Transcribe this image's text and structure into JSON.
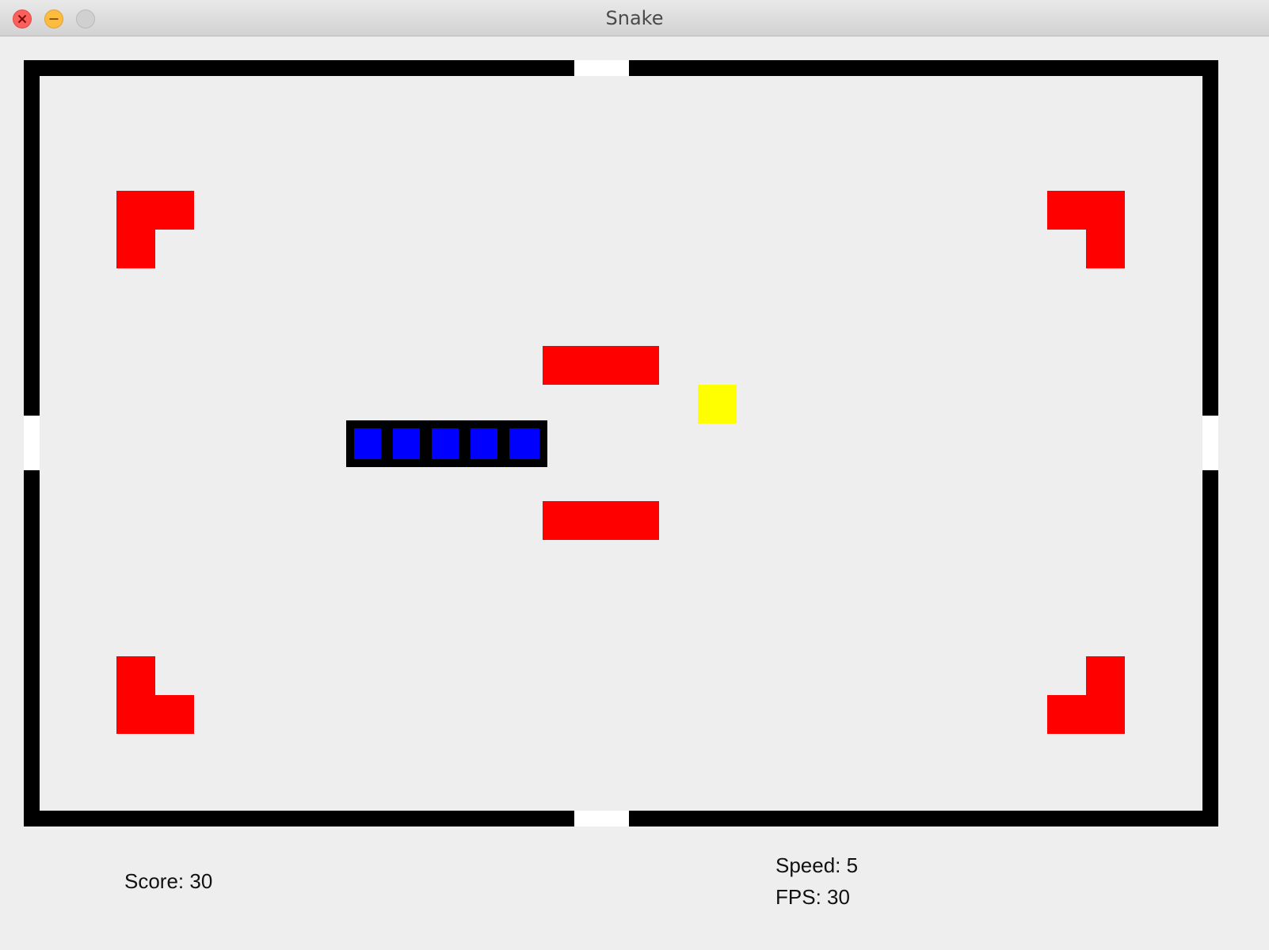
{
  "window": {
    "title": "Snake",
    "controls": [
      "close",
      "minimize",
      "maximize"
    ]
  },
  "colors": {
    "background": "#eeeeee",
    "wall": "#000000",
    "gate": "#ffffff",
    "obstacle": "#ff0000",
    "food": "#ffff00",
    "snake_body": "#0000ff",
    "snake_outline": "#000000"
  },
  "game": {
    "snake_length": 5,
    "direction": "right",
    "food_count": 1,
    "obstacles": [
      "corner-top-left",
      "corner-top-right",
      "corner-bottom-left",
      "corner-bottom-right",
      "bar-upper-center",
      "bar-lower-center"
    ],
    "gates": [
      "top",
      "bottom",
      "left",
      "right"
    ]
  },
  "hud": {
    "score_label": "Score: 30",
    "speed_label": "Speed: 5",
    "fps_label": "FPS: 30"
  }
}
